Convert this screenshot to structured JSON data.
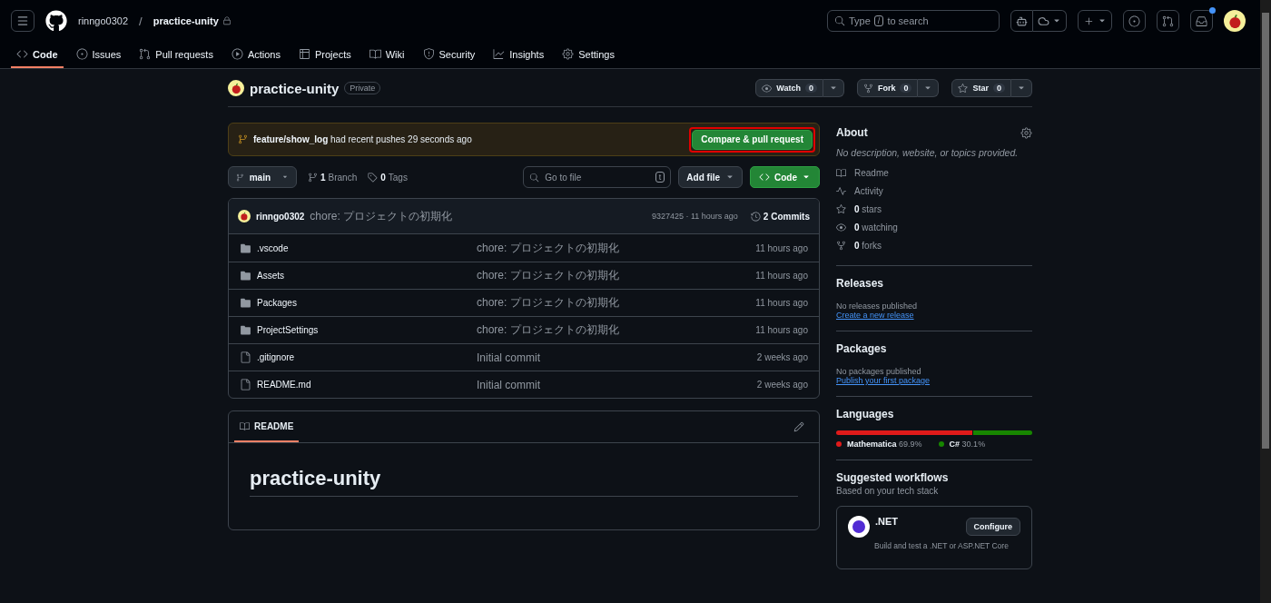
{
  "header": {
    "owner": "rinngo0302",
    "separator": "/",
    "repo": "practice-unity",
    "search_prefix": "Type",
    "search_key": "/",
    "search_suffix": "to search",
    "notification_unread": true
  },
  "nav_tabs": [
    {
      "label": "Code",
      "selected": true
    },
    {
      "label": "Issues",
      "selected": false
    },
    {
      "label": "Pull requests",
      "selected": false
    },
    {
      "label": "Actions",
      "selected": false
    },
    {
      "label": "Projects",
      "selected": false
    },
    {
      "label": "Wiki",
      "selected": false
    },
    {
      "label": "Security",
      "selected": false
    },
    {
      "label": "Insights",
      "selected": false
    },
    {
      "label": "Settings",
      "selected": false
    }
  ],
  "repo_header": {
    "name": "practice-unity",
    "visibility": "Private",
    "actions": [
      {
        "kind": "watch",
        "label": "Watch",
        "count": "0"
      },
      {
        "kind": "fork",
        "label": "Fork",
        "count": "0"
      },
      {
        "kind": "star",
        "label": "Star",
        "count": "0"
      }
    ]
  },
  "push_banner": {
    "branch": "feature/show_log",
    "message": "had recent pushes 29 seconds ago",
    "button": "Compare & pull request"
  },
  "toolbar": {
    "branch": "main",
    "branches_count": "1",
    "branches_label": "Branch",
    "tags_count": "0",
    "tags_label": "Tags",
    "search_placeholder": "Go to file",
    "search_key": "t",
    "add_file": "Add file",
    "code": "Code"
  },
  "latest_commit": {
    "author": "rinngo0302",
    "message": "chore: プロジェクトの初期化",
    "hash_time": "9327425 · 11 hours ago",
    "commits_count": "2",
    "commits_label": "Commits"
  },
  "files": [
    {
      "kind": "folder",
      "name": ".vscode",
      "message": "chore: プロジェクトの初期化",
      "time": "11 hours ago"
    },
    {
      "kind": "folder",
      "name": "Assets",
      "message": "chore: プロジェクトの初期化",
      "time": "11 hours ago"
    },
    {
      "kind": "folder",
      "name": "Packages",
      "message": "chore: プロジェクトの初期化",
      "time": "11 hours ago"
    },
    {
      "kind": "folder",
      "name": "ProjectSettings",
      "message": "chore: プロジェクトの初期化",
      "time": "11 hours ago"
    },
    {
      "kind": "file",
      "name": ".gitignore",
      "message": "Initial commit",
      "time": "2 weeks ago"
    },
    {
      "kind": "file",
      "name": "README.md",
      "message": "Initial commit",
      "time": "2 weeks ago"
    }
  ],
  "readme": {
    "tab": "README",
    "heading": "practice-unity"
  },
  "about": {
    "title": "About",
    "description": "No description, website, or topics provided.",
    "links": [
      {
        "kind": "readme",
        "label": "Readme"
      },
      {
        "kind": "activity",
        "label": "Activity"
      },
      {
        "kind": "stars",
        "count": "0",
        "label": "stars"
      },
      {
        "kind": "watching",
        "count": "0",
        "label": "watching"
      },
      {
        "kind": "forks",
        "count": "0",
        "label": "forks"
      }
    ]
  },
  "releases": {
    "title": "Releases",
    "note": "No releases published",
    "link": "Create a new release"
  },
  "packages": {
    "title": "Packages",
    "note": "No packages published",
    "link": "Publish your first package"
  },
  "languages": {
    "title": "Languages",
    "items": [
      {
        "name": "Mathematica",
        "percent": "69.9%",
        "level": 0.699,
        "color": "#e01a1a"
      },
      {
        "name": "C#",
        "percent": "30.1%",
        "level": 0.301,
        "color": "#178600"
      }
    ]
  },
  "workflows": {
    "title": "Suggested workflows",
    "subtitle": "Based on your tech stack",
    "card": {
      "name": ".NET",
      "button": "Configure",
      "description": "Build and test a .NET or ASP.NET Core"
    }
  }
}
